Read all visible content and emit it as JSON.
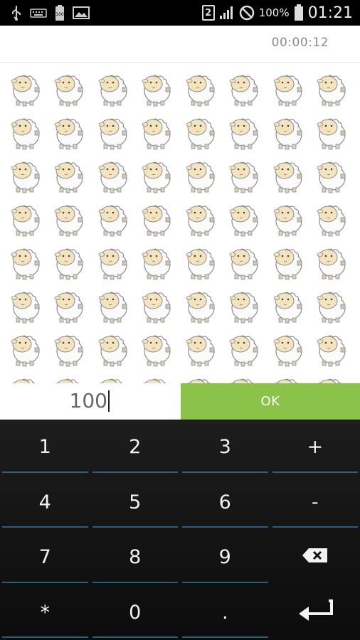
{
  "status_bar": {
    "battery_text": "100%",
    "clock": "01:21",
    "sim_label": "2",
    "icons": [
      "usb-icon",
      "keyboard-icon",
      "battery-notification-icon",
      "image-icon",
      "sim-icon",
      "signal-icon",
      "no-sound-icon",
      "battery-icon"
    ]
  },
  "timer": {
    "value": "00:00:12"
  },
  "sheep": {
    "count_visible": 64,
    "icon": "sheep-icon"
  },
  "input": {
    "value": "100"
  },
  "ok_button": {
    "label": "OK"
  },
  "keypad": {
    "keys": [
      {
        "label": "1"
      },
      {
        "label": "2"
      },
      {
        "label": "3"
      },
      {
        "label": "+"
      },
      {
        "label": "4"
      },
      {
        "label": "5"
      },
      {
        "label": "6"
      },
      {
        "label": "-"
      },
      {
        "label": "7"
      },
      {
        "label": "8"
      },
      {
        "label": "9"
      },
      {
        "label": "",
        "icon": "backspace-icon"
      },
      {
        "label": "*"
      },
      {
        "label": "0"
      },
      {
        "label": "."
      },
      {
        "label": "",
        "icon": "enter-icon"
      }
    ]
  },
  "colors": {
    "ok_green": "#8bc34a",
    "keypad_bg": "#111111",
    "key_underline": "#2f6f9a"
  }
}
